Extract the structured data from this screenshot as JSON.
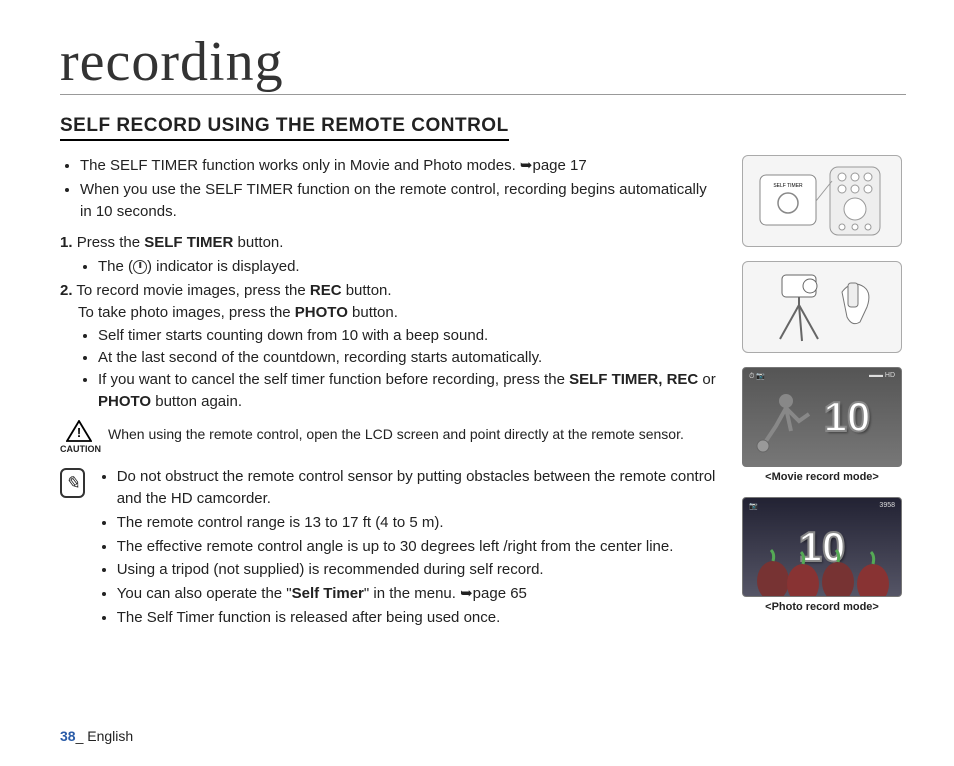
{
  "title": "recording",
  "section_heading": "SELF RECORD USING THE REMOTE CONTROL",
  "intro_bullets": [
    {
      "pre": "The SELF TIMER function works only in Movie and Photo modes. ",
      "ref": "➥page 17"
    },
    {
      "pre": "When you use the SELF TIMER function on the remote control, recording begins automatically in 10 seconds.",
      "ref": ""
    }
  ],
  "steps": {
    "s1": {
      "num": "1.",
      "a": "Press the ",
      "b": "SELF TIMER",
      "c": " button.",
      "sub_a": "The (",
      "sub_b": ") indicator is displayed."
    },
    "s2": {
      "num": "2.",
      "line1_a": "To record movie images, press the ",
      "line1_b": "REC",
      "line1_c": " button.",
      "line2_a": "To take photo images, press the ",
      "line2_b": "PHOTO",
      "line2_c": " button.",
      "subs": [
        "Self timer starts counting down from 10 with a beep sound.",
        "At the last second of the countdown, recording starts automatically."
      ],
      "sub3_a": "If you want to cancel the self timer function before recording, press the ",
      "sub3_b": "SELF TIMER, REC",
      "sub3_c": " or ",
      "sub3_d": "PHOTO",
      "sub3_e": " button again."
    }
  },
  "caution": {
    "label": "CAUTION",
    "text": "When using the remote control, open the LCD screen and point directly at the remote sensor."
  },
  "notes": [
    "Do not obstruct the remote control sensor by putting obstacles between the remote control and the HD camcorder.",
    "The remote control range is 13 to 17 ft (4 to 5 m).",
    "The effective remote control angle is up to 30 degrees left /right from the center line.",
    "Using a tripod (not supplied) is recommended during self record."
  ],
  "note_selftimer": {
    "a": "You can also operate the \"",
    "b": "Self Timer",
    "c": "\" in the menu. ",
    "ref": "➥page 65"
  },
  "note_last": "The Self Timer function is released after being used once.",
  "side": {
    "remote_label": "SELF TIMER",
    "movie_num": "10",
    "movie_caption": "<Movie record mode>",
    "photo_num": "10",
    "photo_caption": "<Photo record mode>",
    "photo_top_left": "📷",
    "photo_top_right": "3958"
  },
  "footer": {
    "page": "38",
    "sep": "_ ",
    "lang": "English"
  }
}
